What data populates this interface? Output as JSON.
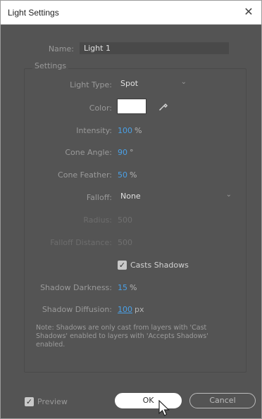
{
  "dialog": {
    "title": "Light Settings",
    "close_glyph": "✕"
  },
  "name": {
    "label": "Name:",
    "value": "Light 1"
  },
  "settings": {
    "group_title": "Settings",
    "light_type": {
      "label": "Light Type:",
      "value": "Spot"
    },
    "color": {
      "label": "Color:",
      "swatch": "#ffffff"
    },
    "intensity": {
      "label": "Intensity:",
      "value": "100",
      "unit": "%"
    },
    "cone_angle": {
      "label": "Cone Angle:",
      "value": "90",
      "unit": "°"
    },
    "cone_feather": {
      "label": "Cone Feather:",
      "value": "50",
      "unit": "%"
    },
    "falloff": {
      "label": "Falloff:",
      "value": "None"
    },
    "radius": {
      "label": "Radius:",
      "value": "500"
    },
    "falloff_distance": {
      "label": "Falloff Distance:",
      "value": "500"
    },
    "casts_shadows": {
      "label": "Casts Shadows",
      "checked": true
    },
    "shadow_darkness": {
      "label": "Shadow Darkness:",
      "value": "15",
      "unit": "%"
    },
    "shadow_diffusion": {
      "label": "Shadow Diffusion:",
      "value": "100",
      "unit": "px"
    },
    "note": "Note: Shadows are only cast from layers with 'Cast Shadows' enabled to layers with 'Accepts Shadows' enabled."
  },
  "footer": {
    "preview_label": "Preview",
    "preview_checked": true,
    "ok_label": "OK",
    "cancel_label": "Cancel"
  }
}
